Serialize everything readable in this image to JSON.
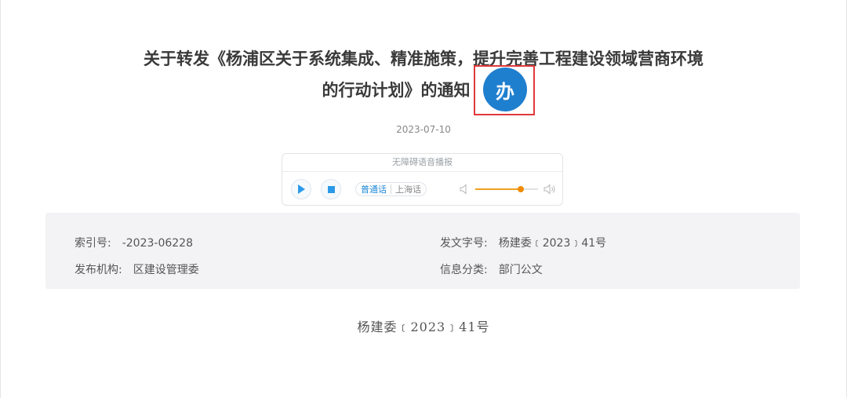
{
  "article": {
    "title_line1": "关于转发《杨浦区关于系统集成、精准施策，提升完善工程建设领域营商环境",
    "title_line2": "的行动计划》的通知",
    "badge_text": "办",
    "date": "2023-07-10"
  },
  "player": {
    "title": "无障碍语音播报",
    "lang_selected": "普通话",
    "lang_other": "上海话",
    "volume_level": 0.72,
    "accent_color": "#1f88d8",
    "volume_color": "#f08a00"
  },
  "info": {
    "index_label": "索引号:",
    "index_value": "-2023-06228",
    "doc_no_label": "发文字号:",
    "doc_no_value": "杨建委﹝2023﹞41号",
    "publisher_label": "发布机构:",
    "publisher_value": "区建设管理委",
    "category_label": "信息分类:",
    "category_value": "部门公文"
  },
  "body": {
    "doc_number": "杨建委﹝2023﹞41号"
  },
  "colors": {
    "badge_blue": "#1f7fcf",
    "highlight_red": "#e03a3a",
    "info_bg": "#f3f3f6"
  }
}
